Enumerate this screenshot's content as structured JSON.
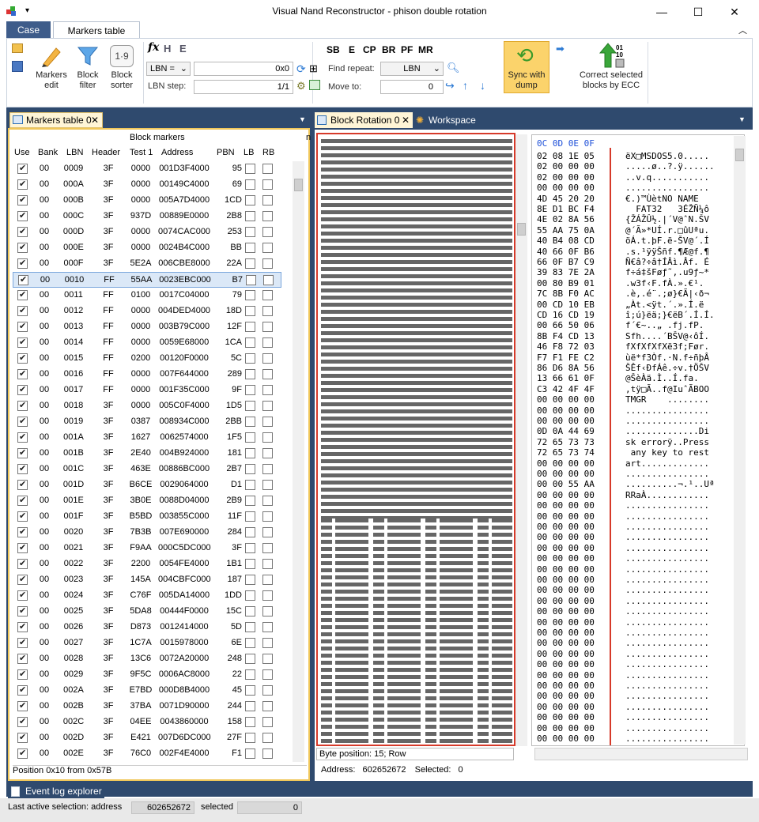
{
  "window": {
    "title": "Visual Nand Reconstructor - phison double rotation"
  },
  "ribbon": {
    "tabs": [
      "Case",
      "Markers table"
    ],
    "buttons": {
      "markers_edit": "Markers edit",
      "block_filter": "Block filter",
      "block_sorter": "Block sorter",
      "sync_with_dump": "Sync with dump",
      "correct_blocks": "Correct selected blocks by ECC"
    },
    "flags": [
      "SB",
      "E",
      "CP",
      "BR",
      "PF",
      "MR"
    ],
    "lbn_mode": "LBN =",
    "lbn_value": "0x0",
    "lbn_step_label": "LBN step:",
    "lbn_step_value": "1/1",
    "find_repeat_label": "Find repeat:",
    "find_repeat_value": "LBN",
    "move_to_label": "Move to:",
    "move_to_value": "0"
  },
  "left_panel": {
    "tab_label": "Markers table 0",
    "group_header": "Block markers",
    "columns": [
      "Use",
      "Bank",
      "LBN",
      "Header",
      "Test 1",
      "Address",
      "PBN",
      "LB",
      "RB"
    ],
    "rows": [
      [
        "00",
        "0009",
        "3F",
        "0000",
        "001D3F4000",
        "95"
      ],
      [
        "00",
        "000A",
        "3F",
        "0000",
        "00149C4000",
        "69"
      ],
      [
        "00",
        "000B",
        "3F",
        "0000",
        "005A7D4000",
        "1CD"
      ],
      [
        "00",
        "000C",
        "3F",
        "937D",
        "00889E0000",
        "2B8"
      ],
      [
        "00",
        "000D",
        "3F",
        "0000",
        "0074CAC000",
        "253"
      ],
      [
        "00",
        "000E",
        "3F",
        "0000",
        "0024B4C000",
        "BB"
      ],
      [
        "00",
        "000F",
        "3F",
        "5E2A",
        "006CBE8000",
        "22A"
      ],
      [
        "00",
        "0010",
        "FF",
        "55AA",
        "0023EBC000",
        "B7"
      ],
      [
        "00",
        "0011",
        "FF",
        "0100",
        "0017C04000",
        "79"
      ],
      [
        "00",
        "0012",
        "FF",
        "0000",
        "004DED4000",
        "18D"
      ],
      [
        "00",
        "0013",
        "FF",
        "0000",
        "003B79C000",
        "12F"
      ],
      [
        "00",
        "0014",
        "FF",
        "0000",
        "0059E68000",
        "1CA"
      ],
      [
        "00",
        "0015",
        "FF",
        "0200",
        "00120F0000",
        "5C"
      ],
      [
        "00",
        "0016",
        "FF",
        "0000",
        "007F644000",
        "289"
      ],
      [
        "00",
        "0017",
        "FF",
        "0000",
        "001F35C000",
        "9F"
      ],
      [
        "00",
        "0018",
        "3F",
        "0000",
        "005C0F4000",
        "1D5"
      ],
      [
        "00",
        "0019",
        "3F",
        "0387",
        "008934C000",
        "2BB"
      ],
      [
        "00",
        "001A",
        "3F",
        "1627",
        "0062574000",
        "1F5"
      ],
      [
        "00",
        "001B",
        "3F",
        "2E40",
        "004B924000",
        "181"
      ],
      [
        "00",
        "001C",
        "3F",
        "463E",
        "00886BC000",
        "2B7"
      ],
      [
        "00",
        "001D",
        "3F",
        "B6CE",
        "0029064000",
        "D1"
      ],
      [
        "00",
        "001E",
        "3F",
        "3B0E",
        "0088D04000",
        "2B9"
      ],
      [
        "00",
        "001F",
        "3F",
        "B5BD",
        "003855C000",
        "11F"
      ],
      [
        "00",
        "0020",
        "3F",
        "7B3B",
        "007E690000",
        "284"
      ],
      [
        "00",
        "0021",
        "3F",
        "F9AA",
        "000C5DC000",
        "3F"
      ],
      [
        "00",
        "0022",
        "3F",
        "2200",
        "0054FE4000",
        "1B1"
      ],
      [
        "00",
        "0023",
        "3F",
        "145A",
        "004CBFC000",
        "187"
      ],
      [
        "00",
        "0024",
        "3F",
        "C76F",
        "005DA14000",
        "1DD"
      ],
      [
        "00",
        "0025",
        "3F",
        "5DA8",
        "00444F0000",
        "15C"
      ],
      [
        "00",
        "0026",
        "3F",
        "D873",
        "0012414000",
        "5D"
      ],
      [
        "00",
        "0027",
        "3F",
        "1C7A",
        "0015978000",
        "6E"
      ],
      [
        "00",
        "0028",
        "3F",
        "13C6",
        "0072A20000",
        "248"
      ],
      [
        "00",
        "0029",
        "3F",
        "9F5C",
        "0006AC8000",
        "22"
      ],
      [
        "00",
        "002A",
        "3F",
        "E7BD",
        "000D8B4000",
        "45"
      ],
      [
        "00",
        "002B",
        "3F",
        "37BA",
        "0071D90000",
        "244"
      ],
      [
        "00",
        "002C",
        "3F",
        "04EE",
        "0043860000",
        "158"
      ],
      [
        "00",
        "002D",
        "3F",
        "E421",
        "007D6DC000",
        "27F"
      ],
      [
        "00",
        "002E",
        "3F",
        "76C0",
        "002F4E4000",
        "F1"
      ]
    ],
    "selected_index": 7,
    "status": "Position 0x10 from 0x57B"
  },
  "right_panel": {
    "tabs": [
      "Block Rotation 0",
      "Workspace"
    ],
    "hex_header": "0C 0D 0E 0F",
    "hex_rows": [
      [
        "02 08 1E 05",
        "ëX□MSDOS5.0....."
      ],
      [
        "02 00 00 00",
        ".....ø..?.ÿ......"
      ],
      [
        "02 00 00 00",
        "..v.q..........."
      ],
      [
        "00 00 00 00",
        "................"
      ],
      [
        "4D 45 20 20",
        "€.)™ÙètNO NAME"
      ],
      [
        "8E D1 BC F4",
        "  FAT32   3ÉŽÑ¼ô"
      ],
      [
        "4E 02 8A 56",
        "{ŽÁŽÛ½.|´V@ˆN.ŠV"
      ],
      [
        "55 AA 75 0A",
        "@´Ã»*UÍ.r.□ûUªu."
      ],
      [
        "40 B4 08 CD",
        "öÁ.t.þF.ë-ŠV@´.Í"
      ],
      [
        "40 66 0F B6",
        ".s.¹ÿÿŠñf.¶Æ@f.¶"
      ],
      [
        "66 0F B7 C9",
        "Ñ€â?÷â†ÍÂì.Âf. É"
      ],
      [
        "39 83 7E 2A",
        "f÷á‡šFøƒ˜,.u9ƒ~*"
      ],
      [
        "00 80 B9 01",
        ".w3f‹F.fÀ.».€¹."
      ],
      [
        "7C 8B F0 AC",
        ".è,.é¨.;ø}€Ã|‹ð¬"
      ],
      [
        "00 CD 10 EB",
        "„Àt.<ÿt.´.».Í.ë"
      ],
      [
        "CD 16 CD 19",
        "î;ú}ëä;}€ëB´.Í.Í."
      ],
      [
        "00 66 50 06",
        "f´€~..„ .fj.fP."
      ],
      [
        "8B F4 CD 13",
        "Sfh....´BŠV@‹ôÍ."
      ],
      [
        "46 F8 72 03",
        "fXfXfXfXë3f;Før."
      ],
      [
        "F7 F1 FE C2",
        "ùë*f3Òf.·N.f÷ñþÂ"
      ],
      [
        "86 D6 8A 56",
        "ŠÊf‹ÐfÁê.÷v.†ÖŠV"
      ],
      [
        "13 66 61 0F",
        "@ŠèÀä.Ì..Í.fa."
      ],
      [
        "C3 42 4F 4F",
        ",tÿ□Ã..f@IuˆÃBOO"
      ],
      [
        "00 00 00 00",
        "TMGR    ........"
      ],
      [
        "00 00 00 00",
        "................"
      ],
      [
        "00 00 00 00",
        "................"
      ],
      [
        "0D 0A 44 69",
        "..............Di"
      ],
      [
        "72 65 73 73",
        "sk errorÿ..Press"
      ],
      [
        "72 65 73 74",
        " any key to rest"
      ],
      [
        "00 00 00 00",
        "art............."
      ],
      [
        "00 00 00 00",
        "................"
      ],
      [
        "00 00 55 AA",
        "..........¬.¹..Uª"
      ],
      [
        "00 00 00 00",
        "RRaÀ............"
      ],
      [
        "00 00 00 00",
        "................"
      ],
      [
        "00 00 00 00",
        "................"
      ],
      [
        "00 00 00 00",
        "................"
      ],
      [
        "00 00 00 00",
        "................"
      ],
      [
        "00 00 00 00",
        "................"
      ],
      [
        "00 00 00 00",
        "................"
      ],
      [
        "00 00 00 00",
        "................"
      ],
      [
        "00 00 00 00",
        "................"
      ],
      [
        "00 00 00 00",
        "................"
      ],
      [
        "00 00 00 00",
        "................"
      ],
      [
        "00 00 00 00",
        "................"
      ],
      [
        "00 00 00 00",
        "................"
      ],
      [
        "00 00 00 00",
        "................"
      ],
      [
        "00 00 00 00",
        "................"
      ],
      [
        "00 00 00 00",
        "................"
      ],
      [
        "00 00 00 00",
        "................"
      ],
      [
        "00 00 00 00",
        "................"
      ],
      [
        "00 00 00 00",
        "................"
      ],
      [
        "00 00 00 00",
        "................"
      ],
      [
        "00 00 00 00",
        "................"
      ],
      [
        "00 00 00 00",
        "................"
      ],
      [
        "00 00 00 00",
        "................"
      ],
      [
        "00 00 00 00",
        "................"
      ],
      [
        "00 00 00 00",
        "................"
      ]
    ],
    "byte_position": "Byte position: 15; Row",
    "address_label": "Address:",
    "address_value": "602652672",
    "selected_label": "Selected:",
    "selected_value": "0"
  },
  "bottom": {
    "event_log_tab": "Event log explorer",
    "last_selection_label": "Last active selection:  address",
    "address_value": "602652672",
    "selected_label": "selected",
    "selected_value": "0"
  },
  "colors": {
    "accent": "#3e5c8a",
    "dark_bg": "#2f4a6e",
    "highlight": "#f0c75a",
    "hex_header": "#1d4fd8",
    "bitmap_border": "#d63a2a"
  }
}
